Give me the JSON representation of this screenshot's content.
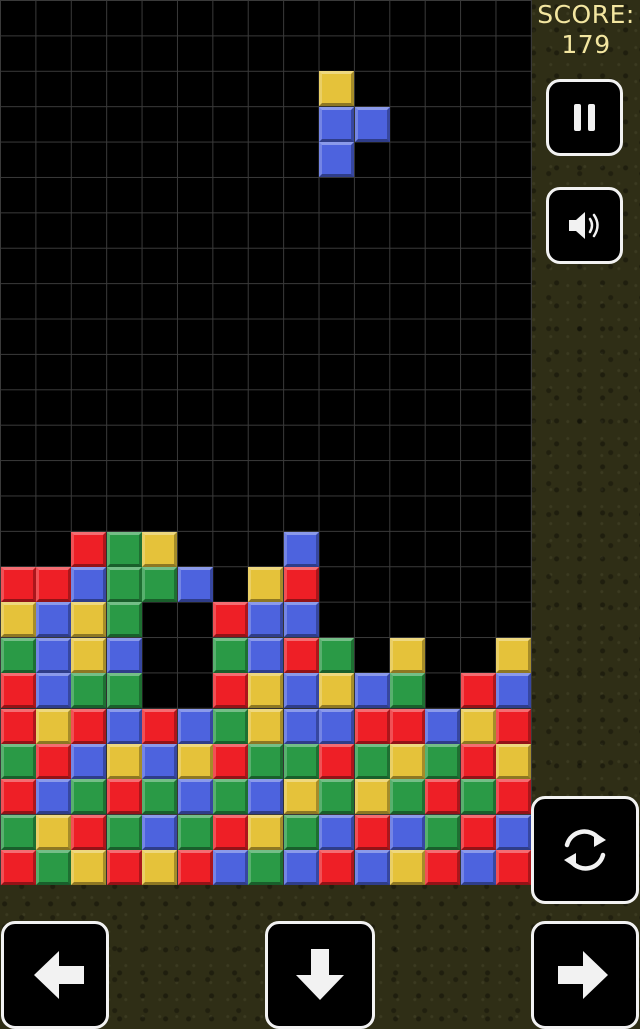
{
  "score": {
    "label": "SCORE:",
    "value": "179"
  },
  "colors": {
    "red": "#ee1f26",
    "green": "#2a9a46",
    "yellow": "#e5c23a",
    "blue": "#4d63de"
  },
  "board": {
    "columns": 15,
    "rows": 25,
    "locked_cells": [
      [
        2,
        15,
        "R"
      ],
      [
        3,
        15,
        "G"
      ],
      [
        4,
        15,
        "Y"
      ],
      [
        8,
        15,
        "B"
      ],
      [
        0,
        16,
        "R"
      ],
      [
        1,
        16,
        "R"
      ],
      [
        2,
        16,
        "B"
      ],
      [
        3,
        16,
        "G"
      ],
      [
        4,
        16,
        "G"
      ],
      [
        5,
        16,
        "B"
      ],
      [
        7,
        16,
        "Y"
      ],
      [
        8,
        16,
        "R"
      ],
      [
        0,
        17,
        "Y"
      ],
      [
        1,
        17,
        "B"
      ],
      [
        2,
        17,
        "Y"
      ],
      [
        3,
        17,
        "G"
      ],
      [
        6,
        17,
        "R"
      ],
      [
        7,
        17,
        "B"
      ],
      [
        8,
        17,
        "B"
      ],
      [
        0,
        18,
        "G"
      ],
      [
        1,
        18,
        "B"
      ],
      [
        2,
        18,
        "Y"
      ],
      [
        3,
        18,
        "B"
      ],
      [
        6,
        18,
        "G"
      ],
      [
        7,
        18,
        "B"
      ],
      [
        8,
        18,
        "R"
      ],
      [
        9,
        18,
        "G"
      ],
      [
        11,
        18,
        "Y"
      ],
      [
        14,
        18,
        "Y"
      ],
      [
        0,
        19,
        "R"
      ],
      [
        1,
        19,
        "B"
      ],
      [
        2,
        19,
        "G"
      ],
      [
        3,
        19,
        "G"
      ],
      [
        6,
        19,
        "R"
      ],
      [
        7,
        19,
        "Y"
      ],
      [
        8,
        19,
        "B"
      ],
      [
        9,
        19,
        "Y"
      ],
      [
        10,
        19,
        "B"
      ],
      [
        11,
        19,
        "G"
      ],
      [
        13,
        19,
        "R"
      ],
      [
        14,
        19,
        "B"
      ],
      [
        0,
        20,
        "R"
      ],
      [
        1,
        20,
        "Y"
      ],
      [
        2,
        20,
        "R"
      ],
      [
        3,
        20,
        "B"
      ],
      [
        4,
        20,
        "R"
      ],
      [
        5,
        20,
        "B"
      ],
      [
        6,
        20,
        "G"
      ],
      [
        7,
        20,
        "Y"
      ],
      [
        8,
        20,
        "B"
      ],
      [
        9,
        20,
        "B"
      ],
      [
        10,
        20,
        "R"
      ],
      [
        11,
        20,
        "R"
      ],
      [
        12,
        20,
        "B"
      ],
      [
        13,
        20,
        "Y"
      ],
      [
        14,
        20,
        "R"
      ],
      [
        0,
        21,
        "G"
      ],
      [
        1,
        21,
        "R"
      ],
      [
        2,
        21,
        "B"
      ],
      [
        3,
        21,
        "Y"
      ],
      [
        4,
        21,
        "B"
      ],
      [
        5,
        21,
        "Y"
      ],
      [
        6,
        21,
        "R"
      ],
      [
        7,
        21,
        "G"
      ],
      [
        8,
        21,
        "G"
      ],
      [
        9,
        21,
        "R"
      ],
      [
        10,
        21,
        "G"
      ],
      [
        11,
        21,
        "Y"
      ],
      [
        12,
        21,
        "G"
      ],
      [
        13,
        21,
        "R"
      ],
      [
        14,
        21,
        "Y"
      ],
      [
        0,
        22,
        "R"
      ],
      [
        1,
        22,
        "B"
      ],
      [
        2,
        22,
        "G"
      ],
      [
        3,
        22,
        "R"
      ],
      [
        4,
        22,
        "G"
      ],
      [
        5,
        22,
        "B"
      ],
      [
        6,
        22,
        "G"
      ],
      [
        7,
        22,
        "B"
      ],
      [
        8,
        22,
        "Y"
      ],
      [
        9,
        22,
        "G"
      ],
      [
        10,
        22,
        "Y"
      ],
      [
        11,
        22,
        "G"
      ],
      [
        12,
        22,
        "R"
      ],
      [
        13,
        22,
        "G"
      ],
      [
        14,
        22,
        "R"
      ],
      [
        0,
        23,
        "G"
      ],
      [
        1,
        23,
        "Y"
      ],
      [
        2,
        23,
        "R"
      ],
      [
        3,
        23,
        "G"
      ],
      [
        4,
        23,
        "B"
      ],
      [
        5,
        23,
        "G"
      ],
      [
        6,
        23,
        "R"
      ],
      [
        7,
        23,
        "Y"
      ],
      [
        8,
        23,
        "G"
      ],
      [
        9,
        23,
        "B"
      ],
      [
        10,
        23,
        "R"
      ],
      [
        11,
        23,
        "B"
      ],
      [
        12,
        23,
        "G"
      ],
      [
        13,
        23,
        "R"
      ],
      [
        14,
        23,
        "B"
      ],
      [
        0,
        24,
        "R"
      ],
      [
        1,
        24,
        "G"
      ],
      [
        2,
        24,
        "Y"
      ],
      [
        3,
        24,
        "R"
      ],
      [
        4,
        24,
        "Y"
      ],
      [
        5,
        24,
        "R"
      ],
      [
        6,
        24,
        "B"
      ],
      [
        7,
        24,
        "G"
      ],
      [
        8,
        24,
        "B"
      ],
      [
        9,
        24,
        "R"
      ],
      [
        10,
        24,
        "B"
      ],
      [
        11,
        24,
        "Y"
      ],
      [
        12,
        24,
        "R"
      ],
      [
        13,
        24,
        "B"
      ],
      [
        14,
        24,
        "R"
      ]
    ],
    "active_piece": [
      [
        9,
        2,
        "Y"
      ],
      [
        9,
        3,
        "B"
      ],
      [
        10,
        3,
        "B"
      ],
      [
        9,
        4,
        "B"
      ]
    ]
  },
  "controls": {
    "pause": "pause-icon",
    "sound": "speaker-icon",
    "rotate": "rotate-icon",
    "left": "arrow-left-icon",
    "down": "arrow-down-icon",
    "right": "arrow-right-icon"
  }
}
